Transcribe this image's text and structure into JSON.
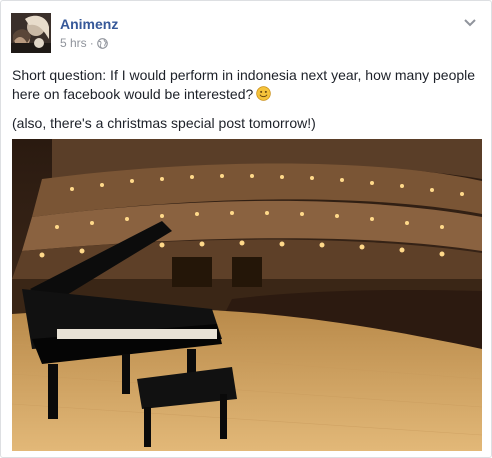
{
  "post": {
    "author": "Animenz",
    "time": "5 hrs",
    "separator": "·",
    "privacy_icon": "globe-icon",
    "options_icon": "chevron-down-icon",
    "paragraphs": [
      "Short question: If I would perform in indonesia next year, how many people here on facebook would be interested?",
      "(also, there's a christmas special post tomorrow!)"
    ],
    "emoji_icon": "smiley-icon",
    "photo_icon": "concert-hall-stage-with-grand-piano"
  },
  "colors": {
    "author_link": "#365899",
    "meta_text": "#90949c",
    "body_text": "#1d2129",
    "emoji_fill": "#f5c33b"
  }
}
